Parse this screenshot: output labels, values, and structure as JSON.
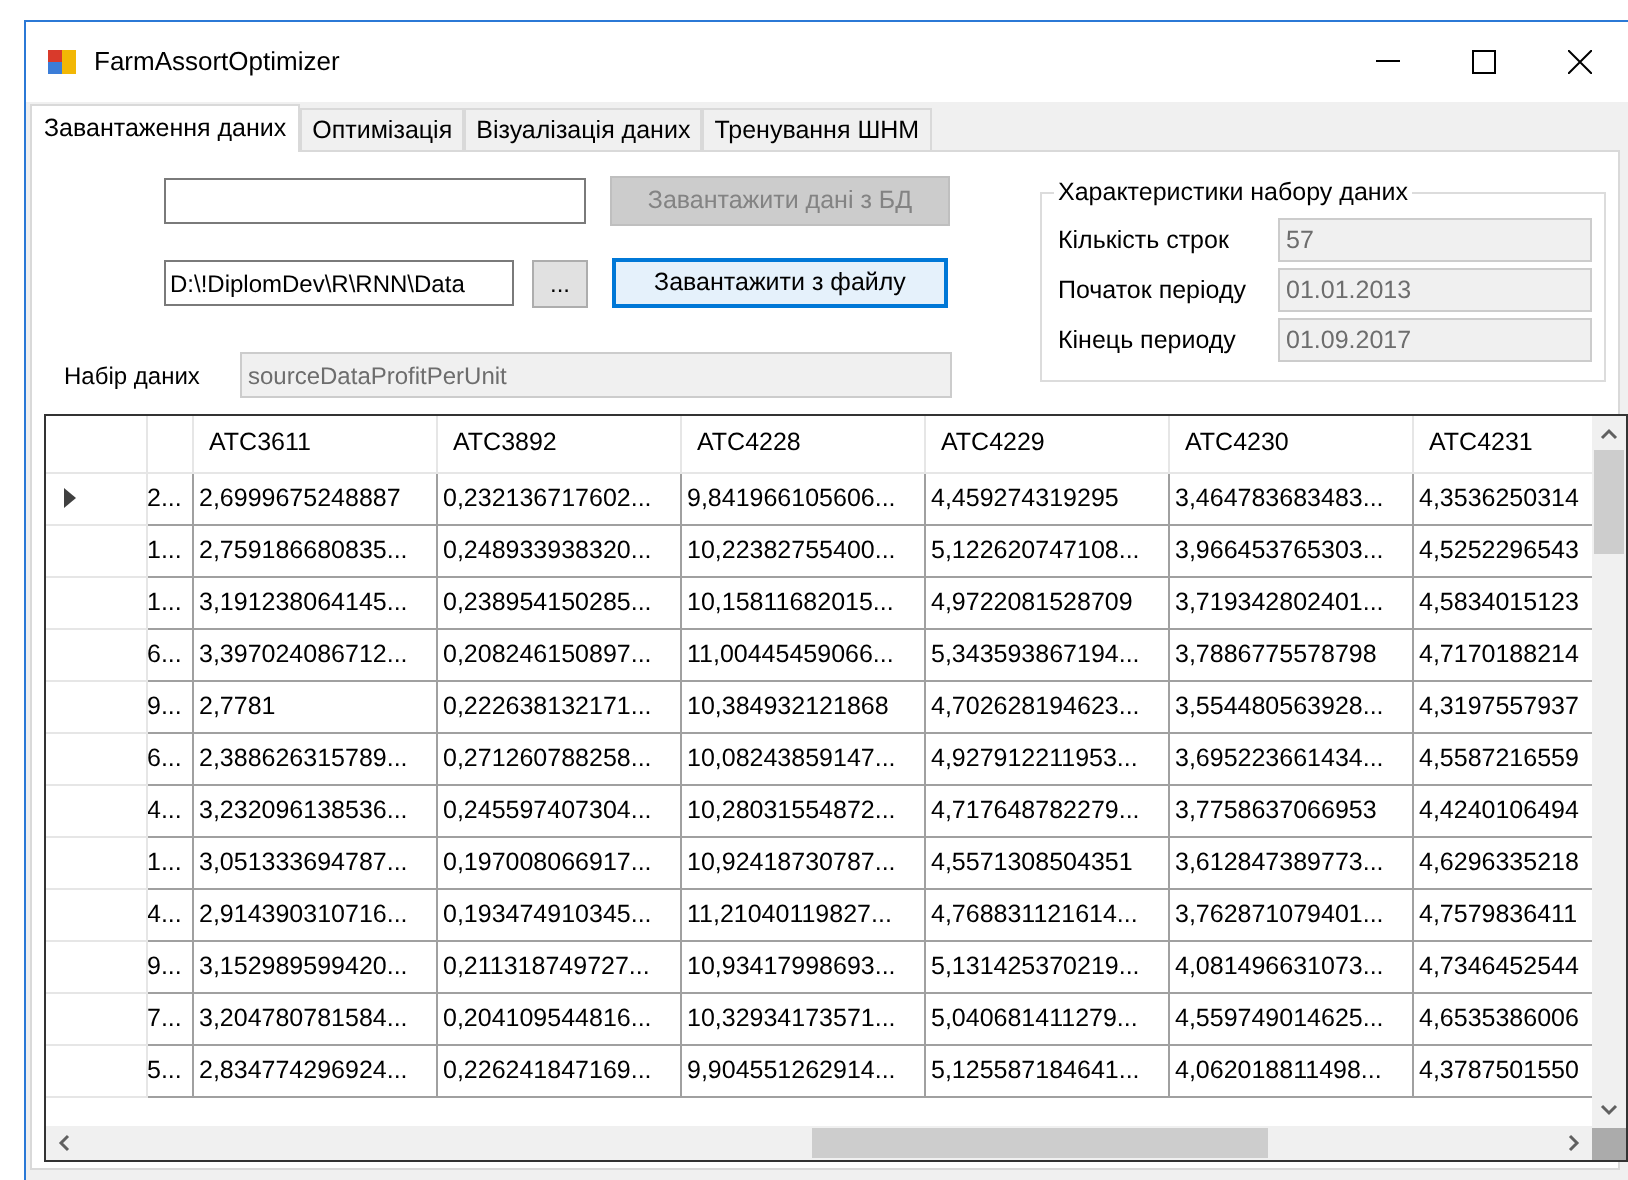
{
  "window": {
    "title": "FarmAssortOptimizer"
  },
  "tabs": [
    {
      "label": "Завантаження даних",
      "selected": true
    },
    {
      "label": "Оптимізація",
      "selected": false
    },
    {
      "label": "Візуалізація даних",
      "selected": false
    },
    {
      "label": "Тренування ШНМ",
      "selected": false
    }
  ],
  "db_button": {
    "label": "Завантажити дані з БД",
    "disabled": true
  },
  "file_field": {
    "value": "D:\\!DiplomDev\\R\\RNN\\Data"
  },
  "browse_button": {
    "label": "..."
  },
  "file_button": {
    "label": "Завантажити з файлу",
    "disabled": false
  },
  "dataset": {
    "label": "Набір даних",
    "value": "sourceDataProfitPerUnit"
  },
  "stats": {
    "title": "Характеристики набору даних",
    "rows": [
      {
        "label": "Кількість строк",
        "value": "57"
      },
      {
        "label": "Початок періоду",
        "value": "01.01.2013"
      },
      {
        "label": "Кінець периоду",
        "value": "01.09.2017"
      }
    ]
  },
  "table": {
    "columns": [
      "",
      "ATC3611",
      "ATC3892",
      "ATC4228",
      "ATC4229",
      "ATC4230",
      "ATC4231"
    ],
    "rows": [
      {
        "current": true,
        "cells": [
          "2...",
          "2,6999675248887",
          "0,232136717602...",
          "9,841966105606...",
          "4,459274319295",
          "3,464783683483...",
          "4,3536250314"
        ]
      },
      {
        "current": false,
        "cells": [
          "1...",
          "2,759186680835...",
          "0,248933938320...",
          "10,22382755400...",
          "5,122620747108...",
          "3,966453765303...",
          "4,5252296543"
        ]
      },
      {
        "current": false,
        "cells": [
          "1...",
          "3,191238064145...",
          "0,238954150285...",
          "10,15811682015...",
          "4,9722081528709",
          "3,719342802401...",
          "4,5834015123"
        ]
      },
      {
        "current": false,
        "cells": [
          "6...",
          "3,397024086712...",
          "0,208246150897...",
          "11,00445459066...",
          "5,343593867194...",
          "3,7886775578798",
          "4,7170188214"
        ]
      },
      {
        "current": false,
        "cells": [
          "9...",
          "2,7781",
          "0,222638132171...",
          "10,384932121868",
          "4,702628194623...",
          "3,554480563928...",
          "4,3197557937"
        ]
      },
      {
        "current": false,
        "cells": [
          "6...",
          "2,388626315789...",
          "0,271260788258...",
          "10,08243859147...",
          "4,927912211953...",
          "3,695223661434...",
          "4,5587216559"
        ]
      },
      {
        "current": false,
        "cells": [
          "4...",
          "3,232096138536...",
          "0,245597407304...",
          "10,28031554872...",
          "4,717648782279...",
          "3,7758637066953",
          "4,4240106494"
        ]
      },
      {
        "current": false,
        "cells": [
          "1...",
          "3,051333694787...",
          "0,197008066917...",
          "10,92418730787...",
          "4,5571308504351",
          "3,612847389773...",
          "4,6296335218"
        ]
      },
      {
        "current": false,
        "cells": [
          "4...",
          "2,914390310716...",
          "0,193474910345...",
          "11,21040119827...",
          "4,768831121614...",
          "3,762871079401...",
          "4,7579836411"
        ]
      },
      {
        "current": false,
        "cells": [
          "9...",
          "3,152989599420...",
          "0,211318749727...",
          "10,93417998693...",
          "5,131425370219...",
          "4,081496631073...",
          "4,7346452544"
        ]
      },
      {
        "current": false,
        "cells": [
          "7...",
          "3,204780781584...",
          "0,204109544816...",
          "10,32934173571...",
          "5,040681411279...",
          "4,559749014625...",
          "4,6535386006"
        ]
      },
      {
        "current": false,
        "cells": [
          "5...",
          "2,834774296924...",
          "0,226241847169...",
          "9,904551262914...",
          "5,125587184641...",
          "4,062018811498...",
          "4,3787501550"
        ]
      }
    ]
  }
}
